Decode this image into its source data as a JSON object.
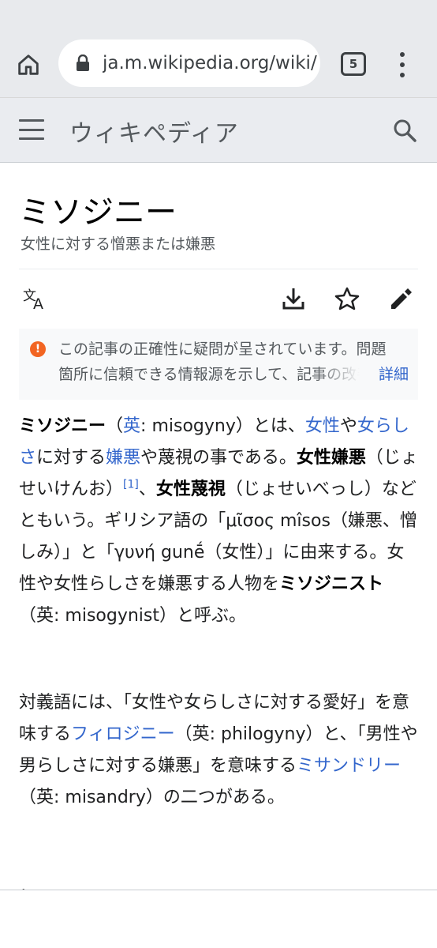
{
  "browser": {
    "url": "ja.m.wikipedia.org/wiki/",
    "tab_count": "5",
    "icons": [
      "home-icon",
      "lock-icon",
      "tabs-icon",
      "more-vert-icon"
    ]
  },
  "wiki_header": {
    "wordmark": "ウィキペディア",
    "icons": [
      "menu-icon",
      "search-icon"
    ]
  },
  "article": {
    "title": "ミソジニー",
    "subtitle": "女性に対する憎悪または嫌悪",
    "toolbar_icons": [
      "translate-icon",
      "download-icon",
      "star-icon",
      "edit-icon"
    ]
  },
  "notice": {
    "line1": "この記事の正確性に疑問が呈されています。問題",
    "line2": "箇所に信頼できる情報源を示して、記事の改善に",
    "more": "詳細",
    "icon_glyph": "!"
  },
  "paragraph1": {
    "t1": "ミソジニー",
    "t2": "（",
    "l1": "英",
    "t3": ": misogyny）とは、",
    "l2": "女性",
    "t4": "や",
    "l3": "女らしさ",
    "t5": "に対する",
    "l4": "嫌悪",
    "t6": "や蔑視の事である。",
    "b1": "女性嫌悪",
    "t7": "（じょせいけんお）",
    "ref": "[1]",
    "t8": "、",
    "b2": "女性蔑視",
    "t9": "（じょせいべっし）などともいう。ギリシア語の「μῖσος mîsos（嫌悪、憎しみ）」と「γυνή gunḗ（女性）」に由来する。女性や女性らしさを嫌悪する人物を",
    "b3": "ミソジニスト",
    "t10": "（英: misogynist）と呼ぶ。"
  },
  "paragraph2": {
    "t1": "対義語には、「女性や女らしさに対する愛好」を意味する",
    "l1": "フィロジニー",
    "t2": "（英: philogyny）と、「男性や男らしさに対する嫌悪」を意味する",
    "l2": "ミサンドリー",
    "t3": "（英: misandry）の二つがある。"
  },
  "section_peek": "概要",
  "colors": {
    "link": "#3366cc",
    "header_bg": "#eaecf0",
    "chrome_bg": "#e8eaed",
    "notice_icon": "#f26522"
  }
}
